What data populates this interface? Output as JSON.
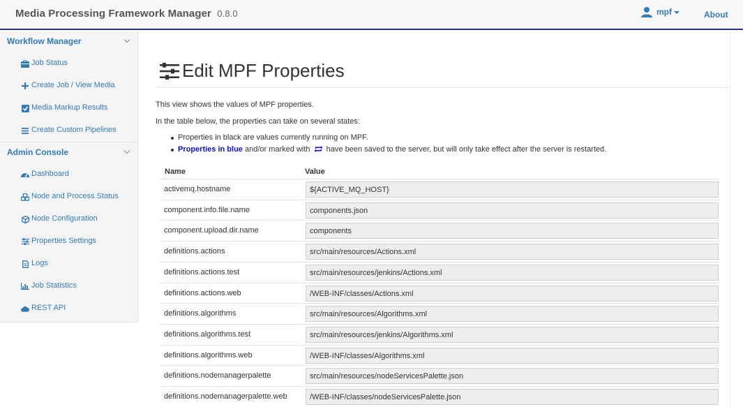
{
  "navbar": {
    "brand": "Media Processing Framework Manager",
    "version": "0.8.0",
    "user": "mpf",
    "about": "About"
  },
  "sidebar": {
    "workflow": {
      "title": "Workflow Manager",
      "items": [
        {
          "label": "Job Status",
          "icon": "briefcase-icon"
        },
        {
          "label": "Create Job / View Media",
          "icon": "plus-icon"
        },
        {
          "label": "Media Markup Results",
          "icon": "check-square-icon"
        },
        {
          "label": "Create Custom Pipelines",
          "icon": "list-icon"
        }
      ]
    },
    "admin": {
      "title": "Admin Console",
      "items": [
        {
          "label": "Dashboard",
          "icon": "dashboard-icon"
        },
        {
          "label": "Node and Process Status",
          "icon": "cubes-icon"
        },
        {
          "label": "Node Configuration",
          "icon": "cube-icon"
        },
        {
          "label": "Properties Settings",
          "icon": "sliders-icon"
        },
        {
          "label": "Logs",
          "icon": "file-icon"
        },
        {
          "label": "Job Statistics",
          "icon": "bar-chart-icon"
        },
        {
          "label": "REST API",
          "icon": "cloud-icon"
        }
      ]
    }
  },
  "main": {
    "title": "Edit MPF Properties",
    "intro": "This view shows the values of MPF properties.",
    "states_intro": "In the table below, the properties can take on several states:",
    "bullet1": "Properties in black are values currently running on MPF.",
    "bullet2_bold": "Properties in blue",
    "bullet2_mid": "and/or marked with",
    "bullet2_end": "have been saved to the server, but will only take effect after the server is restarted.",
    "col_name": "Name",
    "col_value": "Value",
    "rows": [
      {
        "name": "activemq.hostname",
        "value": "${ACTIVE_MQ_HOST}"
      },
      {
        "name": "component.info.file.name",
        "value": "components.json"
      },
      {
        "name": "component.upload.dir.name",
        "value": "components"
      },
      {
        "name": "definitions.actions",
        "value": "src/main/resources/Actions.xml"
      },
      {
        "name": "definitions.actions.test",
        "value": "src/main/resources/jenkins/Actions.xml"
      },
      {
        "name": "definitions.actions.web",
        "value": "/WEB-INF/classes/Actions.xml"
      },
      {
        "name": "definitions.algorithms",
        "value": "src/main/resources/Algorithms.xml"
      },
      {
        "name": "definitions.algorithms.test",
        "value": "src/main/resources/jenkins/Algorithms.xml"
      },
      {
        "name": "definitions.algorithms.web",
        "value": "/WEB-INF/classes/Algorithms.xml"
      },
      {
        "name": "definitions.nodemanagerpalette",
        "value": "src/main/resources/nodeServicesPalette.json"
      },
      {
        "name": "definitions.nodemanagerpalette.web",
        "value": "/WEB-INF/classes/nodeServicesPalette.json"
      }
    ]
  },
  "colors": {
    "link": "#337ab7",
    "pending_blue": "#1010c8",
    "navbar_border": "#2a2f8f"
  }
}
